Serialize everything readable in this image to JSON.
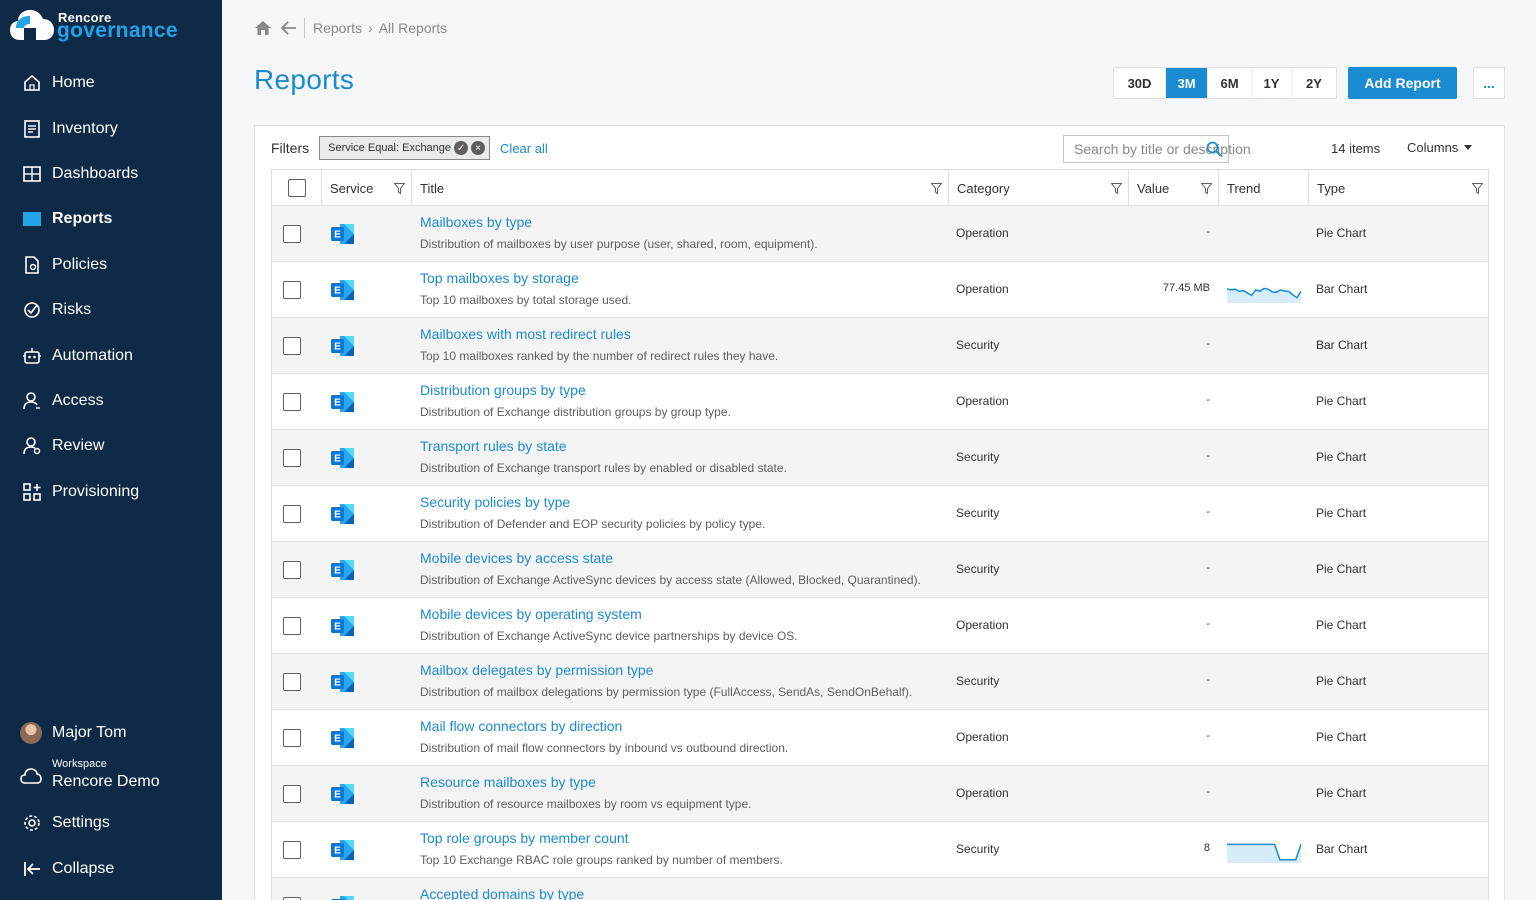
{
  "brand": {
    "small": "Rencore",
    "big": "governance"
  },
  "nav": [
    {
      "label": "Home",
      "icon": "home-icon"
    },
    {
      "label": "Inventory",
      "icon": "inventory-icon"
    },
    {
      "label": "Dashboards",
      "icon": "dashboards-icon"
    },
    {
      "label": "Reports",
      "icon": "reports-icon",
      "active": true
    },
    {
      "label": "Policies",
      "icon": "policies-icon"
    },
    {
      "label": "Risks",
      "icon": "risks-icon"
    },
    {
      "label": "Automation",
      "icon": "automation-icon"
    },
    {
      "label": "Access",
      "icon": "access-icon"
    },
    {
      "label": "Review",
      "icon": "review-icon"
    },
    {
      "label": "Provisioning",
      "icon": "provisioning-icon"
    }
  ],
  "user": {
    "name": "Major Tom"
  },
  "workspace": {
    "label": "Workspace",
    "name": "Rencore Demo"
  },
  "bottom_nav": {
    "settings": "Settings",
    "collapse": "Collapse"
  },
  "breadcrumb": {
    "items": [
      "Reports",
      "All Reports"
    ]
  },
  "page": {
    "title": "Reports"
  },
  "ranges": [
    "30D",
    "3M",
    "6M",
    "1Y",
    "2Y"
  ],
  "range_selected": "3M",
  "actions": {
    "add_report": "Add Report",
    "more": "..."
  },
  "filters": {
    "label": "Filters",
    "chip": "Service Equal: Exchange",
    "clear": "Clear all",
    "search_placeholder": "Search by title or description",
    "count": "14 items",
    "columns": "Columns"
  },
  "columns": {
    "service": "Service",
    "title": "Title",
    "category": "Category",
    "value": "Value",
    "trend": "Trend",
    "type": "Type"
  },
  "colors": {
    "accent": "#1a8bd0",
    "sidebar": "#0e2a47",
    "exchange": "#0a78d4"
  },
  "rows": [
    {
      "title": "Mailboxes by type",
      "desc": "Distribution of mailboxes by user purpose (user, shared, room, equipment).",
      "category": "Operation",
      "value": "-",
      "trend": [],
      "type": "Pie Chart"
    },
    {
      "title": "Top mailboxes by storage",
      "desc": "Top 10 mailboxes by total storage used.",
      "category": "Operation",
      "value": "77.45 MB",
      "trend": [
        0.6,
        0.55,
        0.58,
        0.48,
        0.52,
        0.4,
        0.3,
        0.55,
        0.48,
        0.62,
        0.58,
        0.46,
        0.44,
        0.55,
        0.5,
        0.48,
        0.32,
        0.2,
        0.48
      ],
      "type": "Bar Chart"
    },
    {
      "title": "Mailboxes with most redirect rules",
      "desc": "Top 10 mailboxes ranked by the number of redirect rules they have.",
      "category": "Security",
      "value": "-",
      "trend": [],
      "type": "Bar Chart"
    },
    {
      "title": "Distribution groups by type",
      "desc": "Distribution of Exchange distribution groups by group type.",
      "category": "Operation",
      "value": "-",
      "trend": [],
      "type": "Pie Chart"
    },
    {
      "title": "Transport rules by state",
      "desc": "Distribution of Exchange transport rules by enabled or disabled state.",
      "category": "Security",
      "value": "-",
      "trend": [],
      "type": "Pie Chart"
    },
    {
      "title": "Security policies by type",
      "desc": "Distribution of Defender and EOP security policies by policy type.",
      "category": "Security",
      "value": "-",
      "trend": [],
      "type": "Pie Chart"
    },
    {
      "title": "Mobile devices by access state",
      "desc": "Distribution of Exchange ActiveSync devices by access state (Allowed, Blocked, Quarantined).",
      "category": "Security",
      "value": "-",
      "trend": [],
      "type": "Pie Chart"
    },
    {
      "title": "Mobile devices by operating system",
      "desc": "Distribution of Exchange ActiveSync device partnerships by device OS.",
      "category": "Operation",
      "value": "-",
      "trend": [],
      "type": "Pie Chart"
    },
    {
      "title": "Mailbox delegates by permission type",
      "desc": "Distribution of mailbox delegations by permission type (FullAccess, SendAs, SendOnBehalf).",
      "category": "Security",
      "value": "-",
      "trend": [],
      "type": "Pie Chart"
    },
    {
      "title": "Mail flow connectors by direction",
      "desc": "Distribution of mail flow connectors by inbound vs outbound direction.",
      "category": "Operation",
      "value": "-",
      "trend": [],
      "type": "Pie Chart"
    },
    {
      "title": "Resource mailboxes by type",
      "desc": "Distribution of resource mailboxes by room vs equipment type.",
      "category": "Operation",
      "value": "-",
      "trend": [],
      "type": "Pie Chart"
    },
    {
      "title": "Top role groups by member count",
      "desc": "Top 10 Exchange RBAC role groups ranked by number of members.",
      "category": "Security",
      "value": "8",
      "trend": [
        0.8,
        0.8,
        0.8,
        0.8,
        0.8,
        0.8,
        0.8,
        0.8,
        0.8,
        0.8,
        0.1,
        0.1,
        0.1,
        0.1,
        0.8
      ],
      "type": "Bar Chart"
    },
    {
      "title": "Accepted domains by type",
      "desc": "",
      "category": "",
      "value": "",
      "trend": [],
      "type": ""
    }
  ]
}
